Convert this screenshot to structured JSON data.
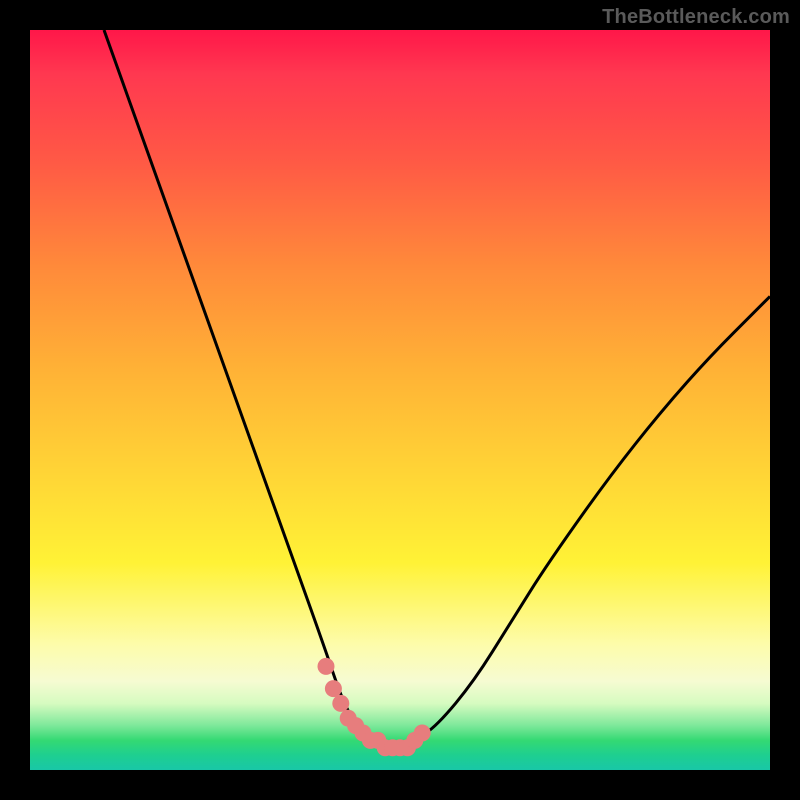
{
  "watermark": "TheBottleneck.com",
  "chart_data": {
    "type": "line",
    "title": "",
    "xlabel": "",
    "ylabel": "",
    "xlim": [
      0,
      100
    ],
    "ylim": [
      0,
      100
    ],
    "grid": false,
    "legend": null,
    "series": [
      {
        "name": "curve",
        "x": [
          10,
          15,
          20,
          25,
          30,
          35,
          40,
          42,
          44,
          46,
          48,
          50,
          52,
          55,
          60,
          65,
          70,
          80,
          90,
          100
        ],
        "y": [
          100,
          86,
          72,
          58,
          44,
          30,
          16,
          10,
          6,
          4,
          3,
          3,
          4,
          6,
          12,
          20,
          28,
          42,
          54,
          64
        ]
      },
      {
        "name": "highlight-dots",
        "x": [
          40,
          41,
          42,
          43,
          44,
          45,
          46,
          47,
          48,
          49,
          50,
          51,
          52,
          53
        ],
        "y": [
          14,
          11,
          9,
          7,
          6,
          5,
          4,
          4,
          3,
          3,
          3,
          3,
          4,
          5
        ]
      }
    ],
    "colors": {
      "curve": "#000000",
      "dots": "#e77d7d",
      "gradient_top": "#ff1749",
      "gradient_mid": "#ffd536",
      "gradient_bottom": "#19c7a7"
    }
  }
}
